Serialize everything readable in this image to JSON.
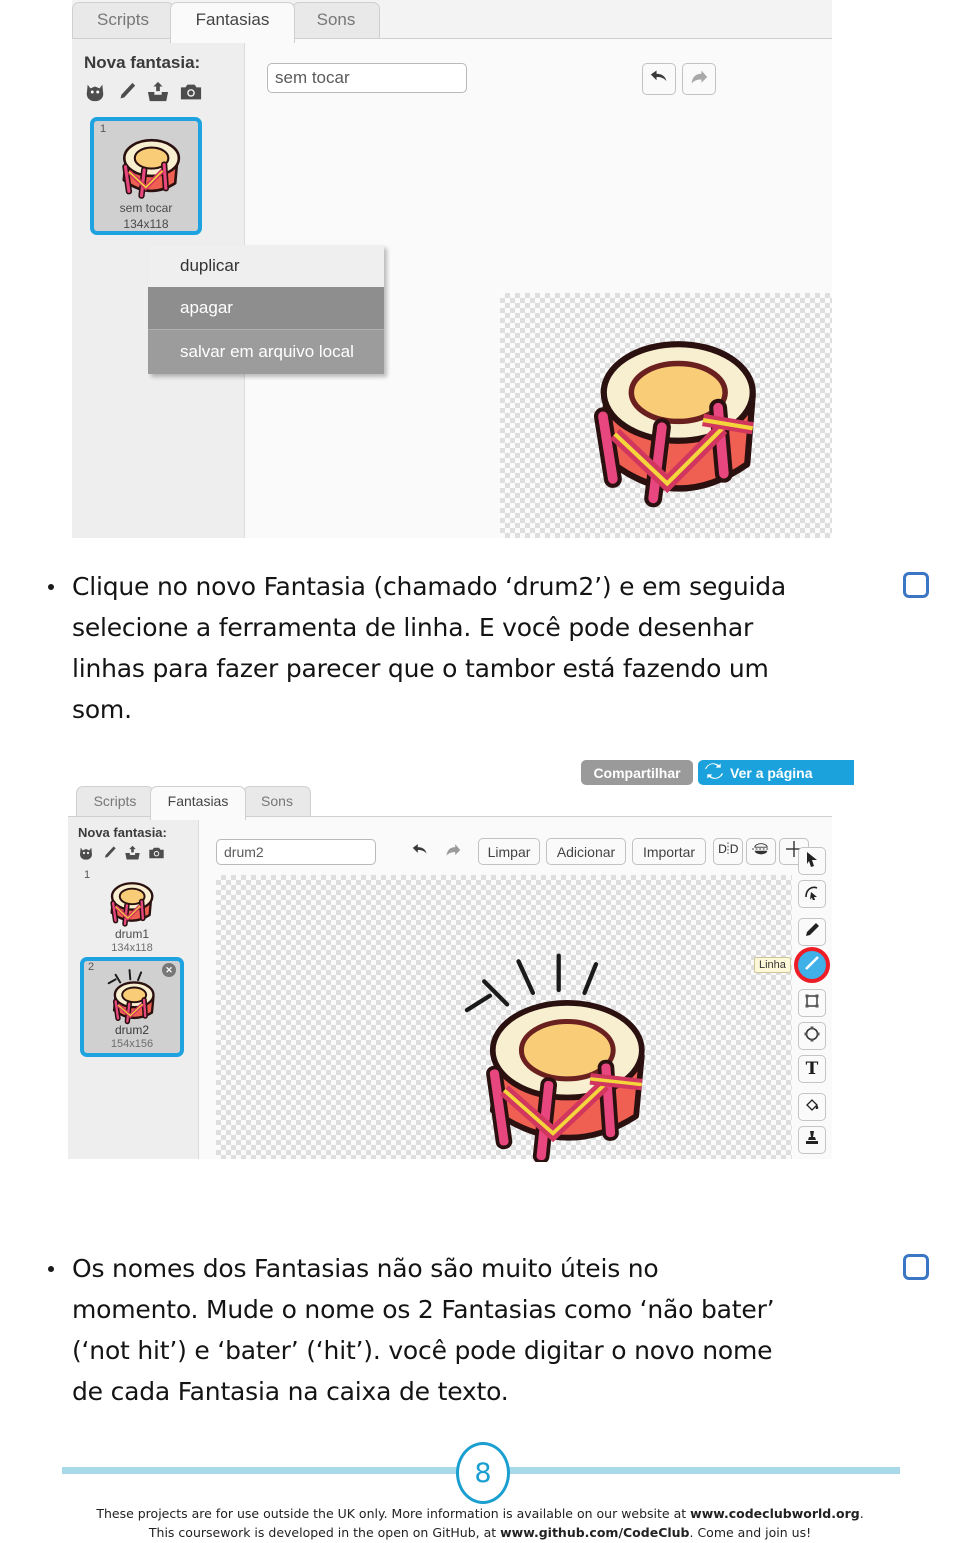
{
  "screenshot_top": {
    "tabs": [
      {
        "label": "Scripts",
        "active": false
      },
      {
        "label": "Fantasias",
        "active": true
      },
      {
        "label": "Sons",
        "active": false
      }
    ],
    "sidebar": {
      "title": "Nova fantasia:",
      "new_costume_icons": [
        "library-cat-icon",
        "paint-brush-icon",
        "upload-icon",
        "camera-icon"
      ],
      "costumes": [
        {
          "index": "1",
          "name": "sem tocar",
          "size": "134x118",
          "selected": true
        }
      ]
    },
    "name_field_value": "sem tocar",
    "toolbar_icons": [
      "undo-icon",
      "redo-icon"
    ],
    "context_menu": {
      "items": [
        "duplicar",
        "apagar",
        "salvar em arquivo local"
      ]
    }
  },
  "paragraph_1": {
    "lines": [
      "Clique no novo Fantasia (chamado ‘drum2’) e em seguida",
      "selecione a ferramenta de linha. E você pode desenhar",
      "linhas para fazer parecer que o tambor está fazendo um",
      "som."
    ],
    "has_checkbox": true
  },
  "screenshot_bottom": {
    "top_buttons": [
      {
        "label": "Compartilhar",
        "color": "#9a9a9a"
      },
      {
        "label": "Ver a página",
        "color": "#1ba2dd",
        "icon": "refresh-icon"
      }
    ],
    "tabs": [
      {
        "label": "Scripts",
        "active": false
      },
      {
        "label": "Fantasias",
        "active": true
      },
      {
        "label": "Sons",
        "active": false
      }
    ],
    "sidebar": {
      "title": "Nova fantasia:",
      "new_costume_icons": [
        "library-cat-icon",
        "paint-brush-icon",
        "upload-icon",
        "camera-icon"
      ],
      "costumes": [
        {
          "index": "1",
          "name": "drum1",
          "size": "134x118",
          "selected": false
        },
        {
          "index": "2",
          "name": "drum2",
          "size": "154x156",
          "selected": true
        }
      ]
    },
    "name_field_value": "drum2",
    "paint_toolbar": {
      "undo": "undo-icon",
      "redo": "redo-icon",
      "buttons": [
        "Limpar",
        "Adicionar",
        "Importar"
      ],
      "transform_icons": [
        "flip-horizontal-icon",
        "flip-vertical-icon",
        "set-costume-center-icon"
      ]
    },
    "tool_palette": {
      "tools": [
        "select-arrow-icon",
        "reshape-icon",
        "pencil-icon",
        "line-icon",
        "rectangle-icon",
        "ellipse-icon",
        "text-icon",
        "fill-bucket-icon",
        "stamp-icon"
      ],
      "active_tool": "line-icon",
      "tooltip": "Linha",
      "highlight_color": "#ee1d25"
    }
  },
  "paragraph_2": {
    "lines": [
      "Os nomes dos Fantasias não são muito úteis no",
      "momento. Mude o nome os 2 Fantasias como ‘não bater’",
      "(‘not hit’) e ‘bater’ (‘hit’). você pode digitar o novo nome",
      "de cada Fantasia na caixa de texto."
    ],
    "has_checkbox": true
  },
  "footer": {
    "page_number": "8",
    "line_1_a": "These projects are for use outside the UK only. More information is available on our website at ",
    "line_1_b": "www.codeclubworld.org",
    "line_1_c": ".",
    "line_2_a": "This coursework is developed in the open on GitHub, at ",
    "line_2_b": "www.github.com/CodeClub",
    "line_2_c": ". Come and join us!"
  },
  "colors": {
    "accent_blue": "#1ea2e0",
    "checkbox_blue": "#3a76c4",
    "highlight_red": "#ee1d25",
    "footer_rule": "#a8d9e8"
  }
}
